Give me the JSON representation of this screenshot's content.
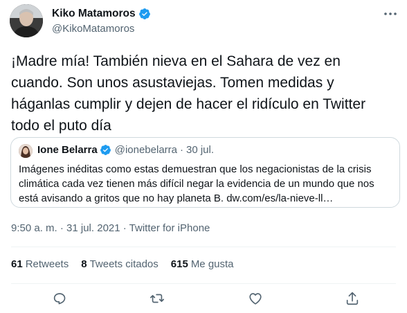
{
  "author": {
    "display_name": "Kiko Matamoros",
    "handle": "@KikoMatamoros",
    "verified": true
  },
  "tweet_text": "¡Madre mía! También nieva en el Sahara de vez en cuando. Son unos asustaviejas. Tomen medidas y háganlas cumplir y dejen de hacer el ridículo en Twitter todo el puto día",
  "quoted": {
    "display_name": "Ione Belarra",
    "handle": "@ionebelarra",
    "separator": "·",
    "date": "30 jul.",
    "text": "Imágenes inéditas como estas demuestran que los negacionistas de la crisis climática cada vez tienen más difícil negar la evidencia de un mundo que nos está avisando a gritos que no hay planeta B. dw.com/es/la-nieve-ll…"
  },
  "meta": "9:50 a. m. · 31 jul. 2021 · Twitter for iPhone",
  "stats": {
    "retweets_count": "61",
    "retweets_label": "Retweets",
    "quotes_count": "8",
    "quotes_label": "Tweets citados",
    "likes_count": "615",
    "likes_label": "Me gusta"
  },
  "icons": {
    "more": "more-icon",
    "reply": "reply-icon",
    "retweet": "retweet-icon",
    "like": "like-icon",
    "share": "share-icon",
    "verified": "verified-badge-icon"
  },
  "colors": {
    "verified": "#1d9bf0",
    "text_primary": "#0f1419",
    "text_secondary": "#536471",
    "border": "#cfd9de"
  }
}
